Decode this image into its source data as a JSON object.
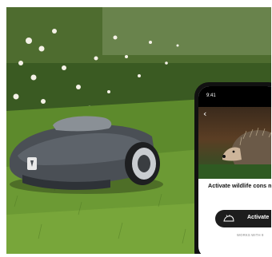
{
  "phone": {
    "status_time": "9:41",
    "back_icon": "chevron-left-icon",
    "mode_title": "Activate wildlife cons mode",
    "activate_label": "Activate",
    "activate_icon": "hedgehog-icon",
    "works_with": "WORKS WITH 9"
  },
  "mower": {
    "brand_logo": "husqvarna-crown-logo",
    "body_color": "#4a4f55"
  },
  "colors": {
    "grass": "#6d9c34",
    "button_dark": "#1d1d1d"
  }
}
